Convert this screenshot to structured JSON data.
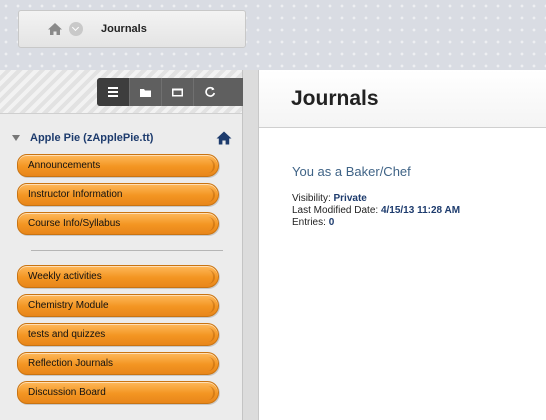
{
  "breadcrumb": {
    "home_icon": "home-icon",
    "dropdown_icon": "chevron-down-icon",
    "current": "Journals"
  },
  "sidebar": {
    "tools": [
      {
        "icon": "list-view-icon",
        "glyph": "☰"
      },
      {
        "icon": "folder-view-icon",
        "glyph": "▬"
      },
      {
        "icon": "window-view-icon",
        "glyph": "▭"
      },
      {
        "icon": "refresh-icon",
        "glyph": "↻"
      }
    ],
    "course_title": "Apple Pie (zApplePie.tt)",
    "menu_group_1": [
      "Announcements",
      "Instructor Information",
      "Course Info/Syllabus"
    ],
    "menu_group_2": [
      "Weekly activities",
      "Chemistry Module",
      "tests and quizzes",
      "Reflection Journals",
      "Discussion Board"
    ]
  },
  "main": {
    "page_title": "Journals",
    "journal": {
      "title": "You as a Baker/Chef",
      "visibility_label": "Visibility:",
      "visibility_value": "Private",
      "modified_label": "Last Modified Date:",
      "modified_value": "4/15/13 11:28 AM",
      "entries_label": "Entries:",
      "entries_value": "0"
    }
  },
  "colors": {
    "menu_orange": "#f39522",
    "course_blue": "#1d3b6d",
    "journal_title_blue": "#3f6386"
  }
}
